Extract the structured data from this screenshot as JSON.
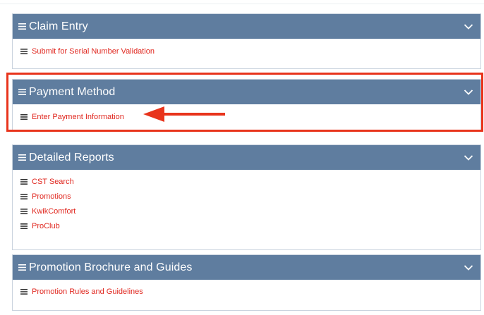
{
  "colors": {
    "header_bg": "#5f7d9f",
    "header_text": "#ffffff",
    "link": "#e0271f",
    "annotation": "#e8341c"
  },
  "panels": [
    {
      "title": "Claim Entry",
      "links": [
        "Submit for Serial Number Validation"
      ]
    },
    {
      "title": "Payment Method",
      "links": [
        "Enter Payment Information"
      ]
    },
    {
      "title": "Detailed Reports",
      "links": [
        "CST Search",
        "Promotions",
        "KwikComfort",
        "ProClub"
      ]
    },
    {
      "title": "Promotion Brochure and Guides",
      "links": [
        "Promotion Rules and Guidelines"
      ]
    }
  ],
  "icons": {
    "header": "list-icon",
    "collapse": "chevron-down-icon",
    "row": "list-icon"
  }
}
